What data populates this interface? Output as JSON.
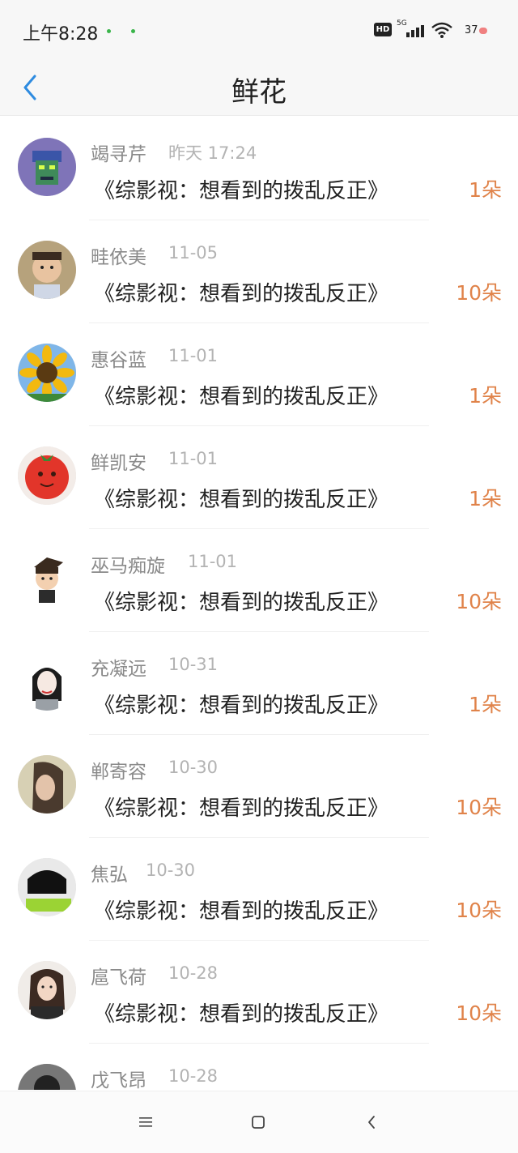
{
  "status": {
    "time": "上午8:28",
    "hd": "HD",
    "net": "5G",
    "battery": "37"
  },
  "header": {
    "title": "鲜花"
  },
  "items": [
    {
      "name": "竭寻芹",
      "date": "昨天 17:24",
      "work": "《综影视：想看到的拨乱反正》",
      "count": "1朵",
      "avatar": "robot-avatar"
    },
    {
      "name": "畦依美",
      "date": "11-05",
      "work": "《综影视：想看到的拨乱反正》",
      "count": "10朵",
      "avatar": "child-avatar"
    },
    {
      "name": "惠谷蓝",
      "date": "11-01",
      "work": "《综影视：想看到的拨乱反正》",
      "count": "1朵",
      "avatar": "sunflower-avatar"
    },
    {
      "name": "鲜凯安",
      "date": "11-01",
      "work": "《综影视：想看到的拨乱反正》",
      "count": "1朵",
      "avatar": "tomato-avatar"
    },
    {
      "name": "巫马痴旋",
      "date": "11-01",
      "work": "《综影视：想看到的拨乱反正》",
      "count": "10朵",
      "avatar": "cartoon-avatar"
    },
    {
      "name": "充凝远",
      "date": "10-31",
      "work": "《综影视：想看到的拨乱反正》",
      "count": "1朵",
      "avatar": "sketch-girl-avatar"
    },
    {
      "name": "郸寄容",
      "date": "10-30",
      "work": "《综影视：想看到的拨乱反正》",
      "count": "10朵",
      "avatar": "woman-avatar"
    },
    {
      "name": "焦弘",
      "date": "10-30",
      "work": "《综影视：想看到的拨乱反正》",
      "count": "10朵",
      "avatar": "glasses-avatar"
    },
    {
      "name": "扈飞荷",
      "date": "10-28",
      "work": "《综影视：想看到的拨乱反正》",
      "count": "10朵",
      "avatar": "portrait-avatar"
    },
    {
      "name": "戊飞昂",
      "date": "10-28",
      "work": "",
      "count": "",
      "avatar": "dark-avatar"
    }
  ]
}
